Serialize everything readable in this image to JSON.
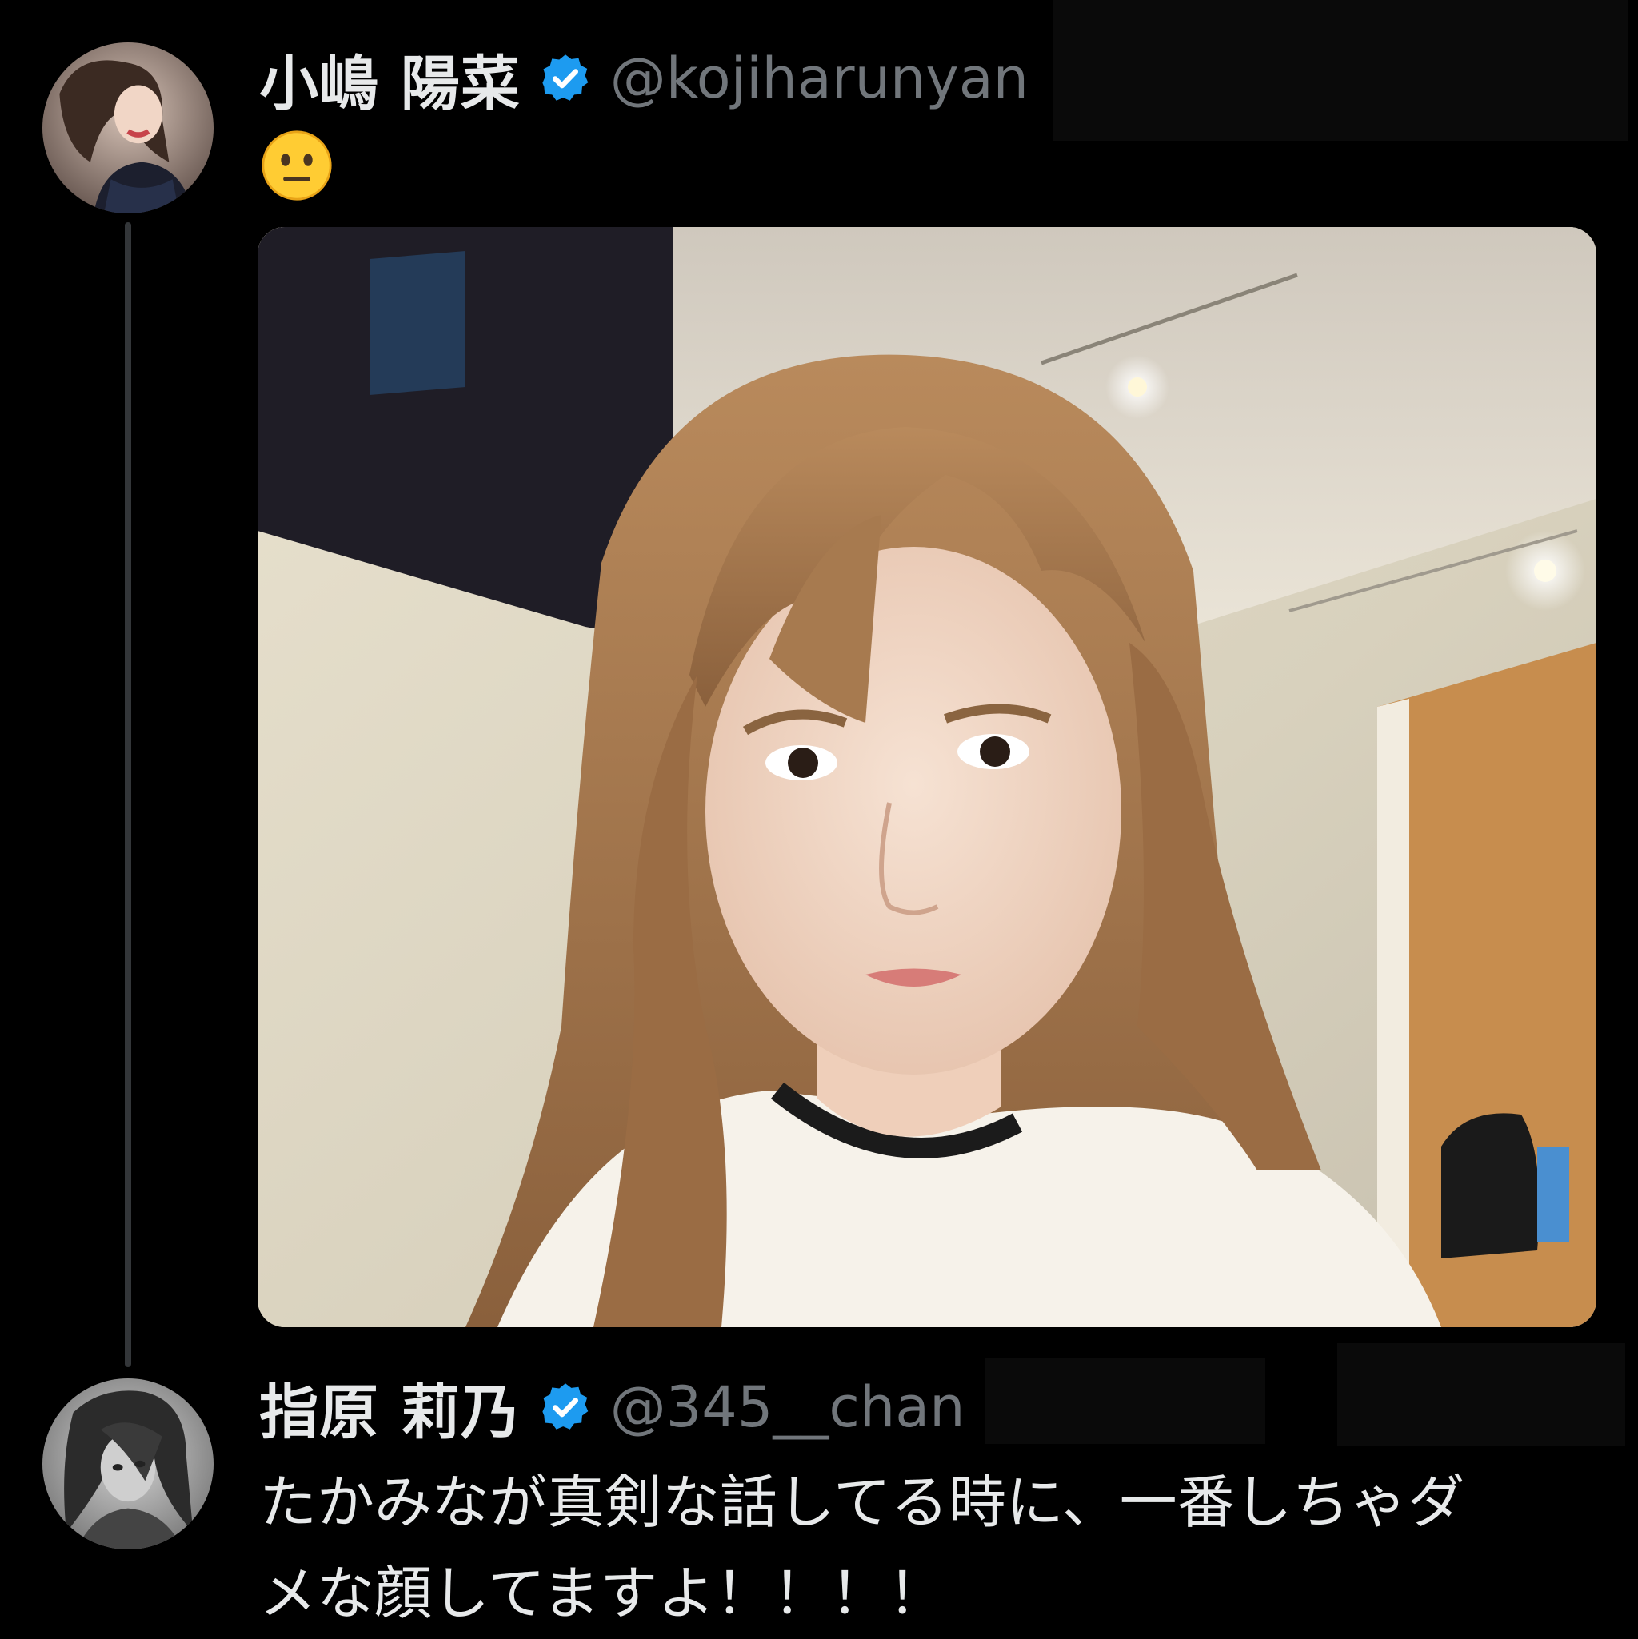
{
  "tweet": {
    "author": {
      "display_name": "小嶋 陽菜",
      "handle": "@kojiharunyan",
      "verified": true,
      "avatar_icon": "profile-photo-kojiharunyan"
    },
    "text_emoji": "😐",
    "emoji_icon": "neutral-face-icon",
    "media_icon": "selfie-photo"
  },
  "reply": {
    "author": {
      "display_name": "指原 莉乃",
      "handle": "@345__chan",
      "verified": true,
      "avatar_icon": "profile-photo-345-chan"
    },
    "text": "たかみなが真剣な話してる時に、一番しちゃダ\nメな顔してますよ！！！！"
  },
  "colors": {
    "background": "#000000",
    "text_primary": "#e7e9ea",
    "text_secondary": "#71767b",
    "verified_blue": "#1d9bf0",
    "thread_line": "#333639"
  }
}
